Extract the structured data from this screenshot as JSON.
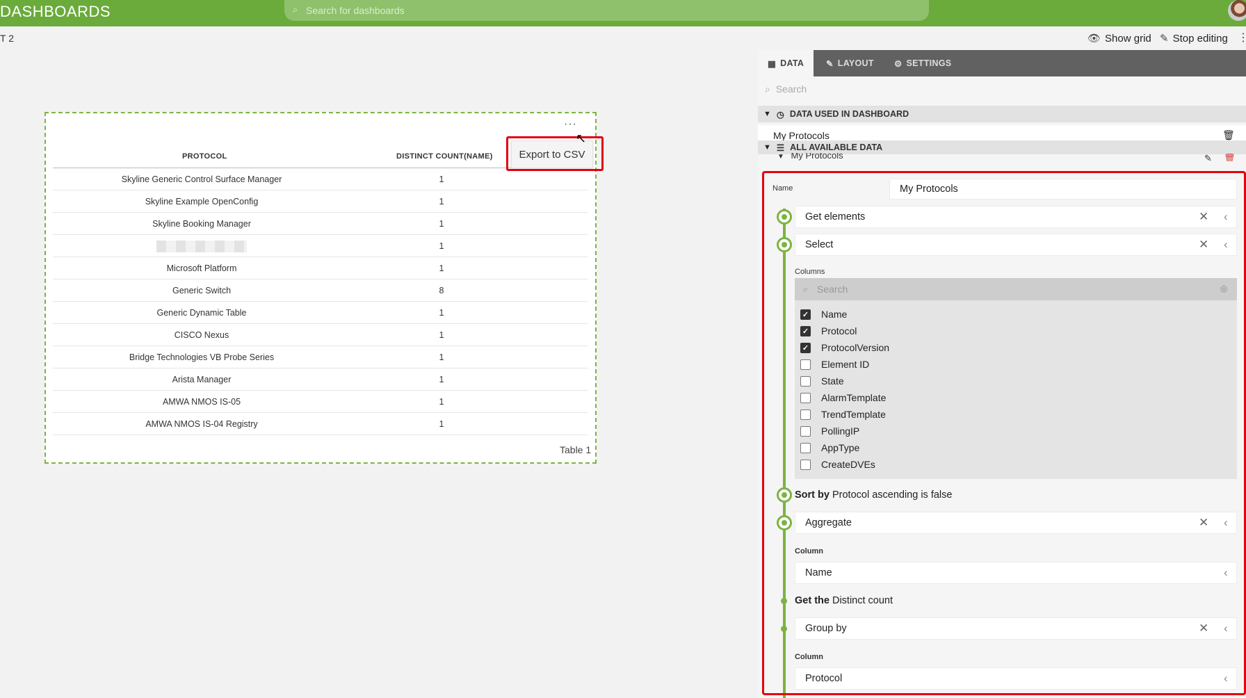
{
  "topbar": {
    "app_title": "DASHBOARDS",
    "search_placeholder": "Search for dashboards"
  },
  "subbar": {
    "page_name": "T 2",
    "show_grid": "Show grid",
    "stop_editing": "Stop editing",
    "more": "⋮"
  },
  "widget": {
    "more": "···",
    "export_label": "Export to CSV",
    "footer": "Table 1",
    "columns": [
      "PROTOCOL",
      "DISTINCT COUNT(NAME)"
    ],
    "rows": [
      {
        "protocol": "Skyline Generic Control Surface Manager",
        "count": "1"
      },
      {
        "protocol": "Skyline Example OpenConfig",
        "count": "1"
      },
      {
        "protocol": "Skyline Booking Manager",
        "count": "1"
      },
      {
        "protocol": "",
        "count": "1"
      },
      {
        "protocol": "Microsoft Platform",
        "count": "1"
      },
      {
        "protocol": "Generic Switch",
        "count": "8"
      },
      {
        "protocol": "Generic Dynamic Table",
        "count": "1"
      },
      {
        "protocol": "CISCO Nexus",
        "count": "1"
      },
      {
        "protocol": "Bridge Technologies VB Probe Series",
        "count": "1"
      },
      {
        "protocol": "Arista Manager",
        "count": "1"
      },
      {
        "protocol": "AMWA NMOS IS-05",
        "count": "1"
      },
      {
        "protocol": "AMWA NMOS IS-04 Registry",
        "count": "1"
      }
    ]
  },
  "panel": {
    "tabs": [
      "DATA",
      "LAYOUT",
      "SETTINGS"
    ],
    "search_placeholder": "Search",
    "used_header": "DATA USED IN DASHBOARD",
    "used_item": "My Protocols",
    "available_header": "ALL AVAILABLE DATA",
    "available_item": "My Protocols",
    "query": {
      "name_label": "Name",
      "name_value": "My Protocols",
      "step_get_elements": "Get elements",
      "step_select": "Select",
      "columns_label": "Columns",
      "columns_search": "Search",
      "columns": [
        {
          "name": "Name",
          "checked": true
        },
        {
          "name": "Protocol",
          "checked": true
        },
        {
          "name": "ProtocolVersion",
          "checked": true
        },
        {
          "name": "Element ID",
          "checked": false
        },
        {
          "name": "State",
          "checked": false
        },
        {
          "name": "AlarmTemplate",
          "checked": false
        },
        {
          "name": "TrendTemplate",
          "checked": false
        },
        {
          "name": "PollingIP",
          "checked": false
        },
        {
          "name": "AppType",
          "checked": false
        },
        {
          "name": "CreateDVEs",
          "checked": false
        }
      ],
      "sort_prefix": "Sort by",
      "sort_text": "Protocol ascending is false",
      "step_aggregate": "Aggregate",
      "column_label": "Column",
      "aggregate_column": "Name",
      "get_prefix": "Get the",
      "get_text": "Distinct count",
      "step_group_by": "Group by",
      "group_column_label": "Column",
      "group_column": "Protocol"
    }
  },
  "colors": {
    "brand_green": "#6aab3c",
    "highlight_red": "#e3000f",
    "timeline_green": "#7cb342"
  }
}
